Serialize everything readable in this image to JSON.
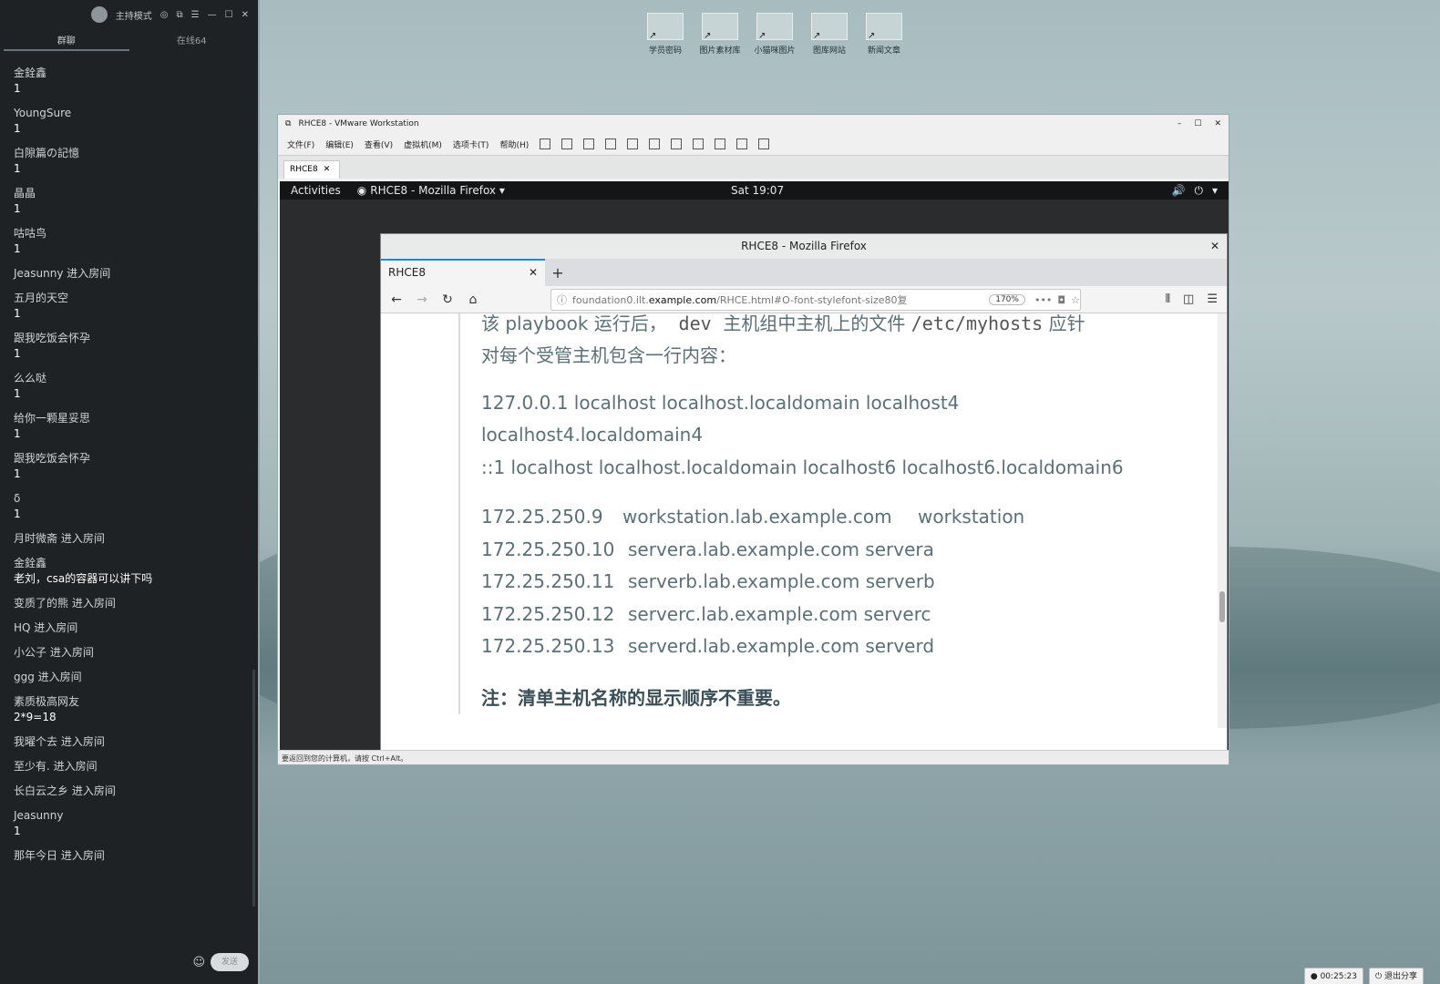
{
  "sidebar": {
    "title": "主持模式",
    "tabs": [
      {
        "label": "群聊"
      },
      {
        "label": "在线64"
      }
    ],
    "messages": [
      {
        "name": "金銓鑫",
        "text": "1"
      },
      {
        "name": "YoungSure",
        "text": "1"
      },
      {
        "name": "白隙篇の記憶",
        "text": "1"
      },
      {
        "name": "晶晶",
        "text": "1"
      },
      {
        "name": "咕咕鸟",
        "text": "1"
      },
      {
        "name": "Jeasunny 进入房间",
        "text": ""
      },
      {
        "name": "五月的天空",
        "text": "1"
      },
      {
        "name": "跟我吃饭会怀孕",
        "text": "1"
      },
      {
        "name": "么么哒",
        "text": "1"
      },
      {
        "name": "给你一颗星妥思",
        "text": "1"
      },
      {
        "name": "跟我吃饭会怀孕",
        "text": "1"
      },
      {
        "name": "δ",
        "text": "1"
      },
      {
        "name": "月时微斋 进入房间",
        "text": ""
      },
      {
        "name": "金銓鑫",
        "text": "老刘，csa的容器可以讲下吗"
      },
      {
        "name": "变质了的熊 进入房间",
        "text": ""
      },
      {
        "name": "HQ 进入房间",
        "text": ""
      },
      {
        "name": "小公子 进入房间",
        "text": ""
      },
      {
        "name": "ggg 进入房间",
        "text": ""
      },
      {
        "name": "素质极高网友",
        "text": "2*9=18"
      },
      {
        "name": "我曜个去 进入房间",
        "text": ""
      },
      {
        "name": "至少有. 进入房间",
        "text": ""
      },
      {
        "name": "长白云之乡 进入房间",
        "text": ""
      },
      {
        "name": "Jeasunny",
        "text": "1"
      },
      {
        "name": "那年今日 进入房间",
        "text": ""
      }
    ],
    "send_label": "发送"
  },
  "desktop_icons": [
    {
      "label": "学员密码"
    },
    {
      "label": "图片素材库"
    },
    {
      "label": "小猫咪图片"
    },
    {
      "label": "图库网站"
    },
    {
      "label": "新闻文章"
    }
  ],
  "vmware": {
    "title": "RHCE8 - VMware Workstation",
    "menu": [
      "文件(F)",
      "编辑(E)",
      "查看(V)",
      "虚拟机(M)",
      "选项卡(T)",
      "帮助(H)"
    ],
    "tab": "RHCE8",
    "status": "要返回到您的计算机，请按 Ctrl+Alt。"
  },
  "gnome": {
    "activities": "Activities",
    "app": "RHCE8 - Mozilla Firefox ▾",
    "clock": "Sat 19:07"
  },
  "firefox": {
    "window_title": "RHCE8 - Mozilla Firefox",
    "tab": "RHCE8",
    "url_prefix": "foundation0.ilt.",
    "url_domain": "example.com",
    "url_rest": "/RHCE.html#O-font-stylefont-size80复",
    "zoom": "170%"
  },
  "doc": {
    "line1_a": "该 playbook 运行后，",
    "line1_code": "dev",
    "line1_b": "主机组中主机上的文件",
    "line1_code2": "/etc/myhosts",
    "line1_c": "应针",
    "line2": "对每个受管主机包含一行内容：",
    "hosts1": "127.0.0.1 localhost localhost.localdomain localhost4",
    "hosts2": "localhost4.localdomain4",
    "hosts3": "::1 localhost localhost.localdomain localhost6 localhost6.localdomain6",
    "entries": [
      {
        "ip": "172.25.250.9",
        "fqdn": "workstation.lab.example.com",
        "short": "workstation"
      },
      {
        "ip": "172.25.250.10",
        "fqdn": "servera.lab.example.com servera",
        "short": ""
      },
      {
        "ip": "172.25.250.11",
        "fqdn": "serverb.lab.example.com serverb",
        "short": ""
      },
      {
        "ip": "172.25.250.12",
        "fqdn": "serverc.lab.example.com serverc",
        "short": ""
      },
      {
        "ip": "172.25.250.13",
        "fqdn": "serverd.lab.example.com serverd",
        "short": ""
      }
    ],
    "note": "注：清单主机名称的显示顺序不重要。"
  },
  "taskbar": {
    "timer": "00:25:23",
    "exit": "退出分享"
  }
}
